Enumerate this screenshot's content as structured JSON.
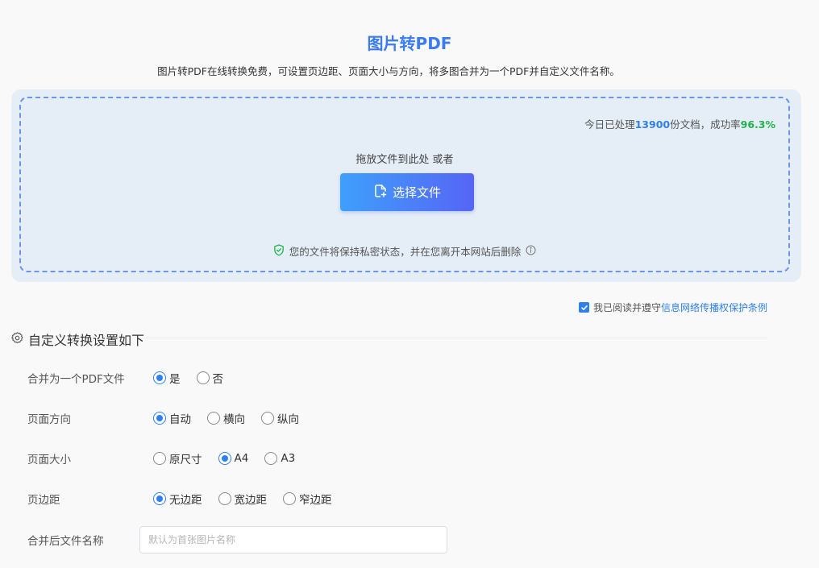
{
  "header": {
    "title": "图片转PDF",
    "subtitle": "图片转PDF在线转换免费，可设置页边距、页面大小与方向，将多图合并为一个PDF并自定义文件名称。"
  },
  "upload": {
    "stats_prefix": "今日已处理",
    "stats_count": "13900",
    "stats_mid": "份文档，成功率",
    "stats_rate": "96.3%",
    "drop_hint": "拖放文件到此处 或者",
    "choose_label": "选择文件",
    "privacy_text": "您的文件将保持私密状态，并在您离开本网站后删除"
  },
  "agreement": {
    "checked": true,
    "prefix": "我已阅读并遵守",
    "link": "信息网络传播权保护条例"
  },
  "settings": {
    "title": "自定义转换设置如下",
    "merge": {
      "label": "合并为一个PDF文件",
      "options": [
        "是",
        "否"
      ],
      "selected": "是"
    },
    "orientation": {
      "label": "页面方向",
      "options": [
        "自动",
        "横向",
        "纵向"
      ],
      "selected": "自动"
    },
    "size": {
      "label": "页面大小",
      "options": [
        "原尺寸",
        "A4",
        "A3"
      ],
      "selected": "A4"
    },
    "margin": {
      "label": "页边距",
      "options": [
        "无边距",
        "宽边距",
        "窄边距"
      ],
      "selected": "无边距"
    },
    "filename": {
      "label": "合并后文件名称",
      "value": "",
      "placeholder": "默认为首张图片名称"
    }
  },
  "icons": {
    "upload_file": "file-plus-icon",
    "privacy": "shield-check-icon",
    "info": "info-icon",
    "settings": "gear-icon"
  },
  "colors": {
    "accent": "#2f80ed",
    "title": "#3b7cf0",
    "success": "#1fb34a",
    "button_gradient_start": "#3ea0fb",
    "button_gradient_end": "#5665f5"
  }
}
